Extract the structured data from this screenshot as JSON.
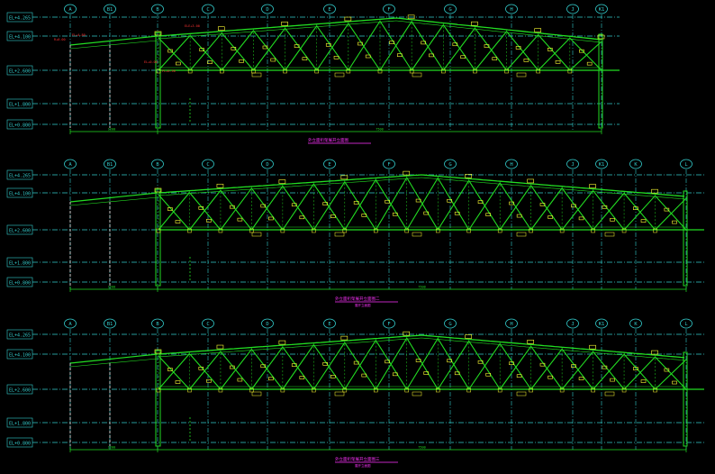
{
  "colors": {
    "background": "#000000",
    "truss": "#22dd22",
    "grid": "#33cccc",
    "bubble": "#33cccc",
    "tag": "#ffff33",
    "dimension": "#ff3333",
    "title": "#ff33ff",
    "column": "#cccccc"
  },
  "elevations": [
    {
      "axis_labels": [
        "A",
        "B1",
        "B",
        "C",
        "D",
        "E",
        "F",
        "G",
        "H",
        "J",
        "K1"
      ],
      "level_labels": [
        "EL+4.265",
        "EL+4.100",
        "EL+2.600",
        "EL+1.800",
        "EL+0.800"
      ],
      "bottom_dims": [
        "1200",
        "7500"
      ],
      "title": "外立面桁架展开立面图",
      "subtitle": ""
    },
    {
      "axis_labels": [
        "A",
        "B1",
        "B",
        "C",
        "D",
        "E",
        "F",
        "G",
        "H",
        "J",
        "K1",
        "K",
        "L"
      ],
      "level_labels": [
        "EL+4.265",
        "EL+4.100",
        "EL+2.600",
        "EL+1.800",
        "EL+0.800"
      ],
      "bottom_dims": [
        "1200",
        "7500"
      ],
      "title": "外立面桁架展开立面图二",
      "subtitle": "展开立面图"
    },
    {
      "axis_labels": [
        "A",
        "B1",
        "B",
        "C",
        "D",
        "E",
        "F",
        "G",
        "H",
        "J",
        "K1",
        "K",
        "L"
      ],
      "level_labels": [
        "EL+4.265",
        "EL+4.100",
        "EL+2.600",
        "EL+1.800",
        "EL+0.800"
      ],
      "bottom_dims": [
        "1200",
        "7500"
      ],
      "title": "外立面桁架展开立面图三",
      "subtitle": "展开立面图"
    }
  ],
  "dimension_labels": [
    "R+0.00",
    "FL+4.80",
    "EL+0.00",
    "FL+0.50",
    "ELE+3.00"
  ]
}
